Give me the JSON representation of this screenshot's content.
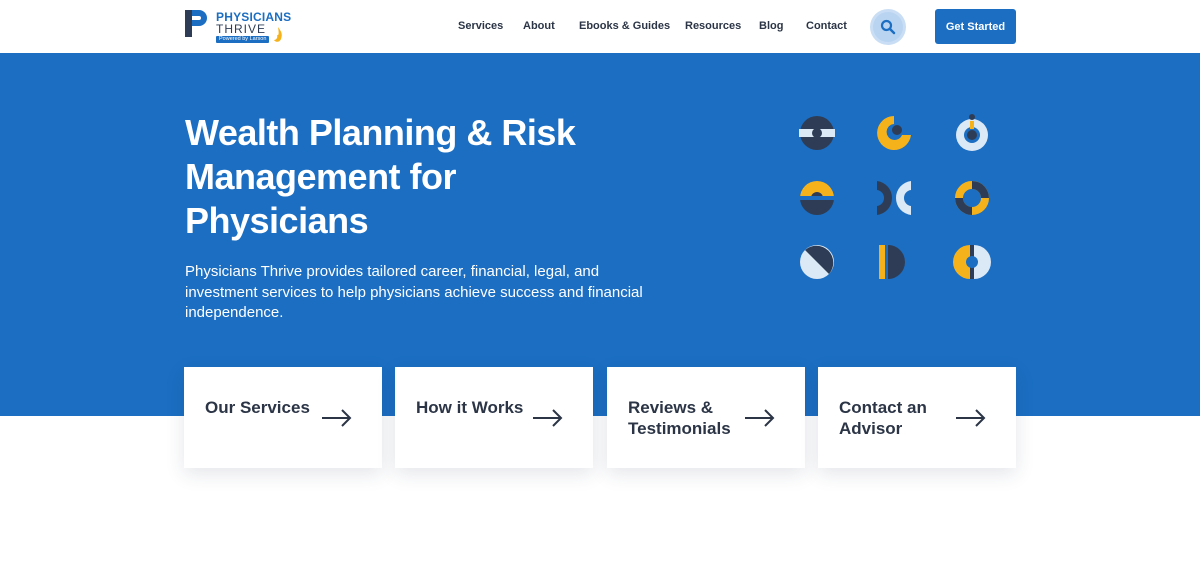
{
  "brand": {
    "name_line1": "PHYSICIANS",
    "name_line2": "THRIVE",
    "tagline": "Powered by Larson",
    "logo_icon": "p-monogram-icon",
    "color_primary": "#1b6ec2",
    "color_dark": "#2b3546",
    "color_accent": "#f5b21b",
    "color_light": "#dbe8f6"
  },
  "nav": {
    "items": [
      {
        "label": "Services"
      },
      {
        "label": "About"
      },
      {
        "label": "Ebooks & Guides"
      },
      {
        "label": "Resources"
      },
      {
        "label": "Blog"
      },
      {
        "label": "Contact"
      }
    ],
    "search_icon": "search-icon",
    "cta_label": "Get Started"
  },
  "hero": {
    "title": "Wealth Planning & Risk Management for Physicians",
    "description": "Physicians Thrive provides tailored career, financial, legal, and investment services to help physicians achieve success and financial independence.",
    "decorative_icons": [
      "circle-band-icon",
      "crescent-dot-icon",
      "drop-ring-icon",
      "split-circle-icon",
      "x-brackets-icon",
      "yellow-ring-icon",
      "diagonal-circle-icon",
      "bar-half-circle-icon",
      "split-rings-icon"
    ]
  },
  "cards": [
    {
      "label": "Our Services",
      "icon": "arrow-right-icon"
    },
    {
      "label": "How it Works",
      "icon": "arrow-right-icon"
    },
    {
      "label": "Reviews & Testimonials",
      "icon": "arrow-right-icon"
    },
    {
      "label": "Contact an Advisor",
      "icon": "arrow-right-icon"
    }
  ]
}
